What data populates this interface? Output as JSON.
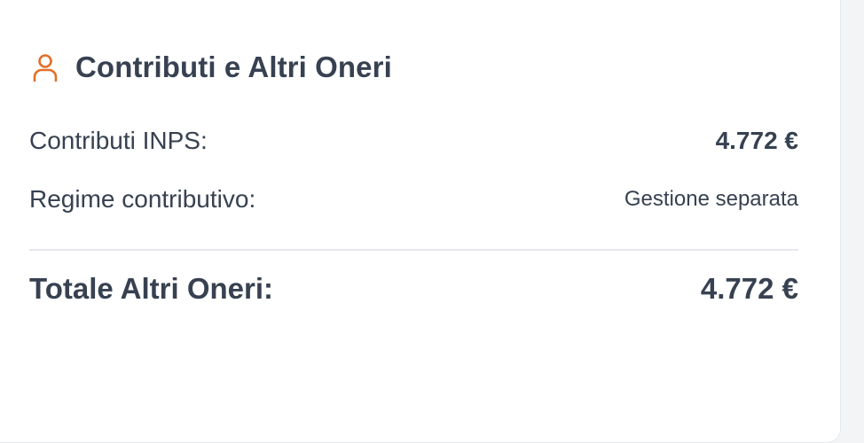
{
  "card": {
    "title": "Contributi e Altri Oneri",
    "icon": "user-icon",
    "accent_color": "#e0702a"
  },
  "rows": {
    "inps": {
      "label": "Contributi INPS:",
      "value": "4.772 €"
    },
    "regime": {
      "label": "Regime contributivo:",
      "value": "Gestione separata"
    }
  },
  "total": {
    "label": "Totale Altri Oneri:",
    "value": "4.772 €"
  }
}
